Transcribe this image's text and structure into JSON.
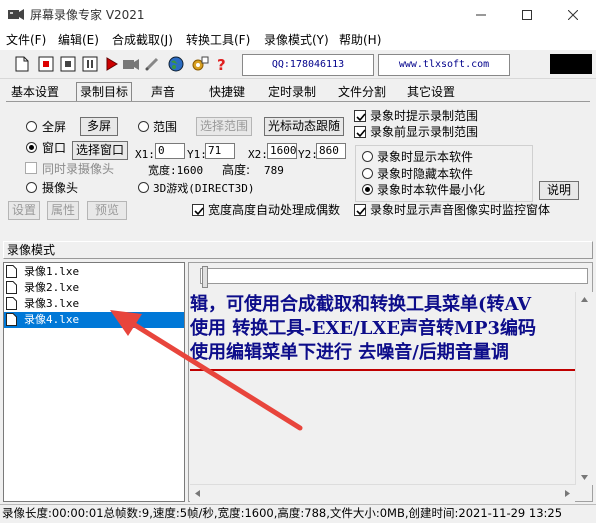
{
  "window": {
    "title": "屏幕录像专家 V2021"
  },
  "menu": [
    "文件(F)",
    "编辑(E)",
    "合成截取(J)",
    "转换工具(F)",
    "录像模式(Y)",
    "帮助(H)"
  ],
  "toolbar": {
    "qq": "QQ:178046113",
    "website": "www.tlxsoft.com"
  },
  "tabs": [
    "基本设置",
    "录制目标",
    "声音",
    "快捷键",
    "定时录制",
    "文件分割",
    "其它设置"
  ],
  "target": {
    "fullscreen": "全屏",
    "multiscreen": "多屏",
    "range": "范围",
    "select_range": "选择范围",
    "cursor_follow": "光标动态跟随",
    "window": "窗口",
    "select_window": "选择窗口",
    "x1_label": "X1:",
    "x1": "0",
    "y1_label": "Y1:",
    "y1": "71",
    "x2_label": "X2:",
    "x2": "1600",
    "y2_label": "Y2:",
    "y2": "860",
    "width_label": "宽度:1600",
    "height_label": "高度:",
    "height_value": "789",
    "record_camera_simul": "同时录摄像头",
    "camera": "摄像头",
    "game3d": "3D游戏(DIRECT3D)",
    "btn_settings": "设置",
    "btn_props": "属性",
    "btn_preview": "预览",
    "auto_wh": "宽度高度自动处理成偶数"
  },
  "options": {
    "prompt_range": "录象时提示录制范围",
    "show_range_before": "录象前显示录制范围",
    "show_soft": "录象时显示本软件",
    "hide_soft": "录象时隐藏本软件",
    "minimize_soft": "录象时本软件最小化",
    "explain": "说明",
    "monitor": "录象时显示声音图像实时监控窗体"
  },
  "mode_label": "录像模式",
  "files": [
    "录像1.lxe",
    "录像2.lxe",
    "录像3.lxe",
    "录像4.lxe"
  ],
  "selected_file": 3,
  "marquee": [
    "辑，可使用合成截取和转换工具菜单(转AV",
    "使用 转换工具-EXE/LXE声音转MP3编码",
    "使用编辑菜单下进行 去噪音/后期音量调"
  ],
  "status": "录像长度:00:00:01总帧数:9,速度:5帧/秒,宽度:1600,高度:788,文件大小:0MB,创建时间:2021-11-29 13:25",
  "colors": {
    "marquee_text": "#0d0d8a",
    "selection": "#0078d7",
    "arrow": "#e8453c"
  }
}
